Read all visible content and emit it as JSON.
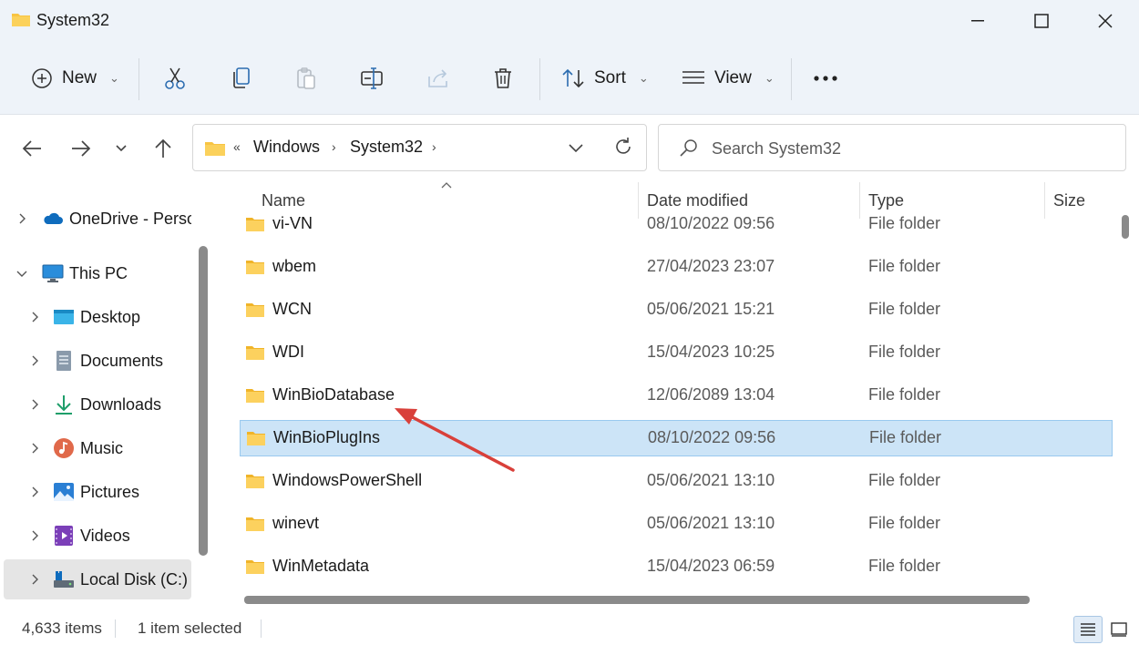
{
  "window": {
    "title": "System32"
  },
  "toolbar": {
    "new_label": "New",
    "sort_label": "Sort",
    "view_label": "View"
  },
  "address": {
    "overflow": "«",
    "crumbs": [
      "Windows",
      "System32"
    ],
    "sep": "›"
  },
  "search": {
    "placeholder": "Search System32"
  },
  "sidebar": {
    "items": [
      {
        "label": "OneDrive - Perso",
        "icon": "onedrive-cloud-icon",
        "expanded": false
      },
      {
        "label": "This PC",
        "icon": "computer-icon",
        "expanded": true
      },
      {
        "label": "Desktop",
        "icon": "desktop-icon",
        "expanded": false
      },
      {
        "label": "Documents",
        "icon": "documents-icon",
        "expanded": false
      },
      {
        "label": "Downloads",
        "icon": "downloads-icon",
        "expanded": false
      },
      {
        "label": "Music",
        "icon": "music-icon",
        "expanded": false
      },
      {
        "label": "Pictures",
        "icon": "pictures-icon",
        "expanded": false
      },
      {
        "label": "Videos",
        "icon": "videos-icon",
        "expanded": false
      },
      {
        "label": "Local Disk (C:)",
        "icon": "drive-icon",
        "expanded": false,
        "selected": true
      }
    ]
  },
  "columns": {
    "name": "Name",
    "date": "Date modified",
    "type": "Type",
    "size": "Size"
  },
  "files": [
    {
      "name": "vi-VN",
      "date": "08/10/2022 09:56",
      "type": "File folder"
    },
    {
      "name": "wbem",
      "date": "27/04/2023 23:07",
      "type": "File folder"
    },
    {
      "name": "WCN",
      "date": "05/06/2021 15:21",
      "type": "File folder"
    },
    {
      "name": "WDI",
      "date": "15/04/2023 10:25",
      "type": "File folder"
    },
    {
      "name": "WinBioDatabase",
      "date": "12/06/2089 13:04",
      "type": "File folder"
    },
    {
      "name": "WinBioPlugIns",
      "date": "08/10/2022 09:56",
      "type": "File folder",
      "selected": true
    },
    {
      "name": "WindowsPowerShell",
      "date": "05/06/2021 13:10",
      "type": "File folder"
    },
    {
      "name": "winevt",
      "date": "05/06/2021 13:10",
      "type": "File folder"
    },
    {
      "name": "WinMetadata",
      "date": "15/04/2023 06:59",
      "type": "File folder"
    }
  ],
  "status": {
    "items": "4,633 items",
    "selected": "1 item selected"
  },
  "colors": {
    "chrome": "#eef3f9",
    "selection": "#cce4f7",
    "folder": "#f8c443",
    "annotation_arrow": "#d9403a"
  }
}
